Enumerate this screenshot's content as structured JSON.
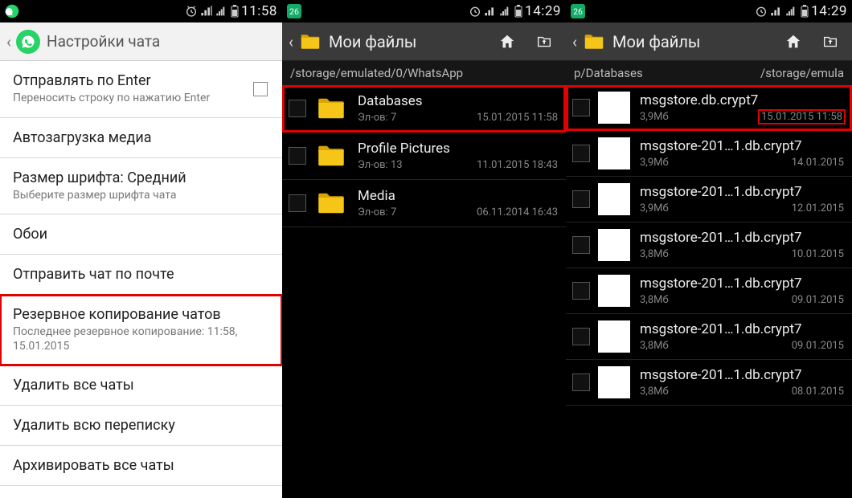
{
  "phone1": {
    "status": {
      "time": "11:58"
    },
    "title": "Настройки чата",
    "rows": [
      {
        "title": "Отправлять по Enter",
        "sub": "Переносить строку по нажатию Enter",
        "checkbox": true
      },
      {
        "title": "Автозагрузка медиа"
      },
      {
        "title": "Размер шрифта: Средний",
        "sub": "Выберите размер шрифта чата"
      },
      {
        "title": "Обои"
      },
      {
        "title": "Отправить чат по почте"
      },
      {
        "title": "Резервное копирование чатов",
        "sub": "Последнее резервное копирование: 11:58, 15.01.2015",
        "highlight": true
      },
      {
        "title": "Удалить все чаты"
      },
      {
        "title": "Удалить всю переписку"
      },
      {
        "title": "Архивировать все чаты"
      }
    ]
  },
  "phone2": {
    "status": {
      "time": "14:29"
    },
    "title": "Мои файлы",
    "crumb": "/storage/emulated/0/WhatsApp",
    "rows": [
      {
        "icon": "folder",
        "name": "Databases",
        "sub": "Эл-ов: 7",
        "date": "15.01.2015 11:58",
        "highlight": true
      },
      {
        "icon": "folder",
        "name": "Profile Pictures",
        "sub": "Эл-ов: 13",
        "date": "11.01.2015 18:43"
      },
      {
        "icon": "folder",
        "name": "Media",
        "sub": "Эл-ов: 7",
        "date": "06.11.2014 16:43"
      }
    ]
  },
  "phone3": {
    "status": {
      "time": "14:29"
    },
    "title": "Мои файлы",
    "crumb_left": "p/Databases",
    "crumb_right": "/storage/emula",
    "rows": [
      {
        "icon": "file",
        "name": "msgstore.db.crypt7",
        "sub": "3,9Мб",
        "date": "15.01.2015 11:58",
        "highlight": true,
        "highlightDate": true
      },
      {
        "icon": "file",
        "name": "msgstore-201…1.db.crypt7",
        "sub": "3,9Мб",
        "date": "14.01.2015"
      },
      {
        "icon": "file",
        "name": "msgstore-201…1.db.crypt7",
        "sub": "3,9Мб",
        "date": "12.01.2015"
      },
      {
        "icon": "file",
        "name": "msgstore-201…1.db.crypt7",
        "sub": "3,8Мб",
        "date": "10.01.2015"
      },
      {
        "icon": "file",
        "name": "msgstore-201…1.db.crypt7",
        "sub": "3,8Мб",
        "date": "09.01.2015"
      },
      {
        "icon": "file",
        "name": "msgstore-201…1.db.crypt7",
        "sub": "3,8Мб",
        "date": "09.01.2015"
      },
      {
        "icon": "file",
        "name": "msgstore-201…1.db.crypt7",
        "sub": "3,8Мб",
        "date": "08.01.2015"
      }
    ]
  }
}
